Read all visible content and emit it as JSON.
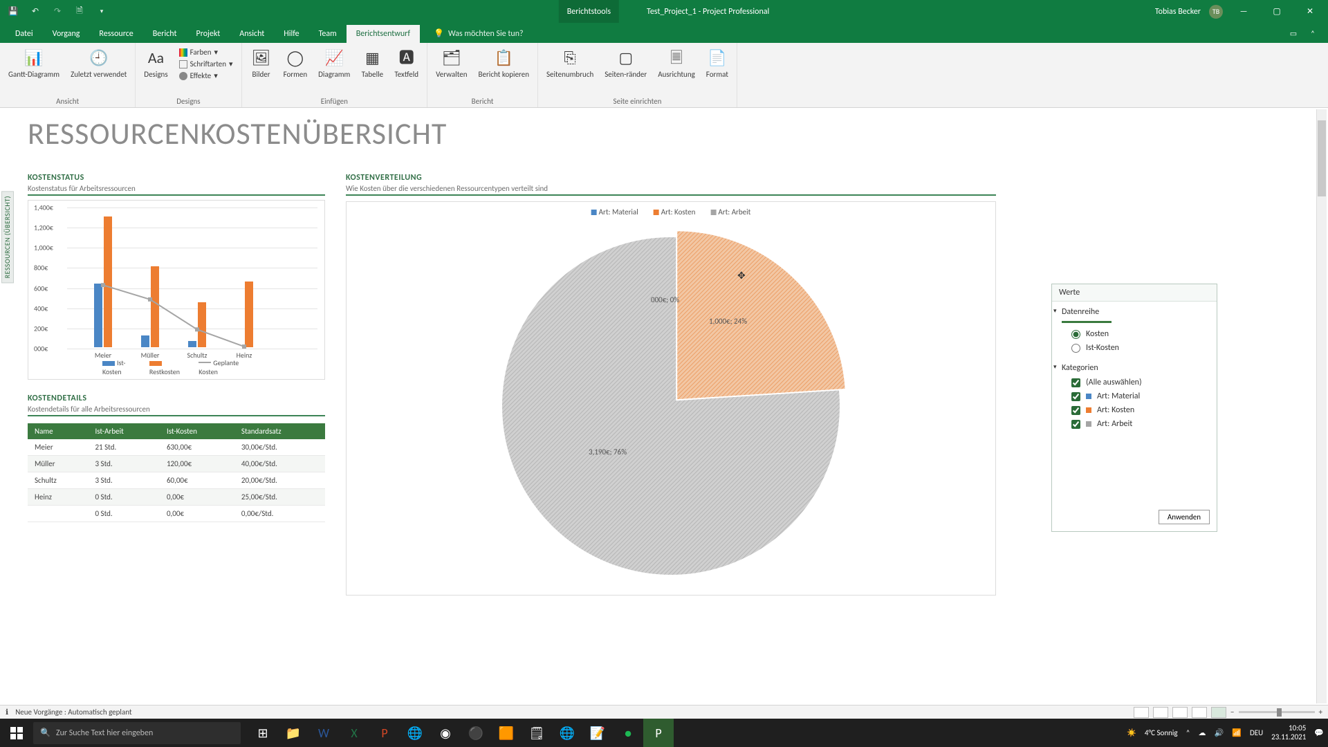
{
  "app": {
    "tools_tab": "Berichtstools",
    "doc_title": "Test_Project_1  -  Project Professional",
    "user": "Tobias Becker",
    "user_initials": "TB"
  },
  "tabs": [
    "Datei",
    "Vorgang",
    "Ressource",
    "Bericht",
    "Projekt",
    "Ansicht",
    "Hilfe",
    "Team",
    "Berichtsentwurf"
  ],
  "active_tab": "Berichtsentwurf",
  "tellme": "Was möchten Sie tun?",
  "ribbon": {
    "ansicht": {
      "label": "Ansicht",
      "gantt": "Gantt-Diagramm",
      "zuletzt": "Zuletzt verwendet"
    },
    "designs": {
      "label": "Designs",
      "btn": "Designs",
      "farben": "Farben",
      "schriftarten": "Schriftarten",
      "effekte": "Effekte"
    },
    "einfuegen": {
      "label": "Einfügen",
      "bilder": "Bilder",
      "formen": "Formen",
      "diagramm": "Diagramm",
      "tabelle": "Tabelle",
      "textfeld": "Textfeld"
    },
    "bericht": {
      "label": "Bericht",
      "verwalten": "Verwalten",
      "kopieren": "Bericht kopieren"
    },
    "seite": {
      "label": "Seite einrichten",
      "umbruch": "Seitenumbruch",
      "raender": "Seiten-ränder",
      "ausrichtung": "Ausrichtung",
      "format": "Format"
    }
  },
  "vtab": "RESSOURCEN (ÜBERSICHT)",
  "report_title": "RESSOURCENKOSTENÜBERSICHT",
  "status": {
    "title": "KOSTENSTATUS",
    "sub": "Kostenstatus für Arbeitsressourcen",
    "legend": {
      "ist": "Ist-Kosten",
      "rest": "Restkosten",
      "plan": "Geplante Kosten"
    }
  },
  "chart_data": [
    {
      "type": "bar",
      "title": "KOSTENSTATUS",
      "xlabel": "",
      "ylabel": "",
      "ylim": [
        0,
        1400
      ],
      "y_ticks": [
        "000€",
        "200€",
        "400€",
        "600€",
        "800€",
        "1,000€",
        "1,200€",
        "1,400€"
      ],
      "categories": [
        "Meier",
        "Müller",
        "Schultz",
        "Heinz"
      ],
      "series": [
        {
          "name": "Ist-Kosten",
          "values": [
            630,
            120,
            60,
            0
          ]
        },
        {
          "name": "Restkosten",
          "values": [
            1300,
            800,
            445,
            650
          ]
        },
        {
          "name": "Geplante Kosten",
          "values": [
            630,
            488,
            190,
            20
          ]
        }
      ]
    },
    {
      "type": "pie",
      "title": "KOSTENVERTEILUNG",
      "categories": [
        "Art: Material",
        "Art: Kosten",
        "Art: Arbeit"
      ],
      "values": [
        0,
        1000,
        3190
      ],
      "labels": [
        "000€; 0%",
        "1,000€; 24%",
        "3,190€; 76%"
      ]
    }
  ],
  "details": {
    "title": "KOSTENDETAILS",
    "sub": "Kostendetails für alle Arbeitsressourcen",
    "headers": [
      "Name",
      "Ist-Arbeit",
      "Ist-Kosten",
      "Standardsatz"
    ],
    "rows": [
      [
        "Meier",
        "21 Std.",
        "630,00€",
        "30,00€/Std."
      ],
      [
        "Müller",
        "3 Std.",
        "120,00€",
        "40,00€/Std."
      ],
      [
        "Schultz",
        "3 Std.",
        "60,00€",
        "20,00€/Std."
      ],
      [
        "Heinz",
        "0 Std.",
        "0,00€",
        "25,00€/Std."
      ],
      [
        "",
        "0 Std.",
        "0,00€",
        "0,00€/Std."
      ]
    ]
  },
  "pie": {
    "title": "KOSTENVERTEILUNG",
    "sub": "Wie Kosten über die verschiedenen Ressourcentypen verteilt sind",
    "legend": [
      "Art: Material",
      "Art: Kosten",
      "Art: Arbeit"
    ]
  },
  "panel": {
    "header": "Werte",
    "group1": "Datenreihe",
    "radio1": "Kosten",
    "radio2": "Ist-Kosten",
    "group2": "Kategorien",
    "all": "(Alle auswählen)",
    "c1": "Art: Material",
    "c2": "Art: Kosten",
    "c3": "Art: Arbeit",
    "apply": "Anwenden"
  },
  "statusbar": {
    "msg": "Neue Vorgänge : Automatisch geplant"
  },
  "taskbar": {
    "search": "Zur Suche Text hier eingeben",
    "weather": "4°C  Sonnig",
    "lang": "DEU",
    "time": "10:05",
    "date": "23.11.2021"
  }
}
